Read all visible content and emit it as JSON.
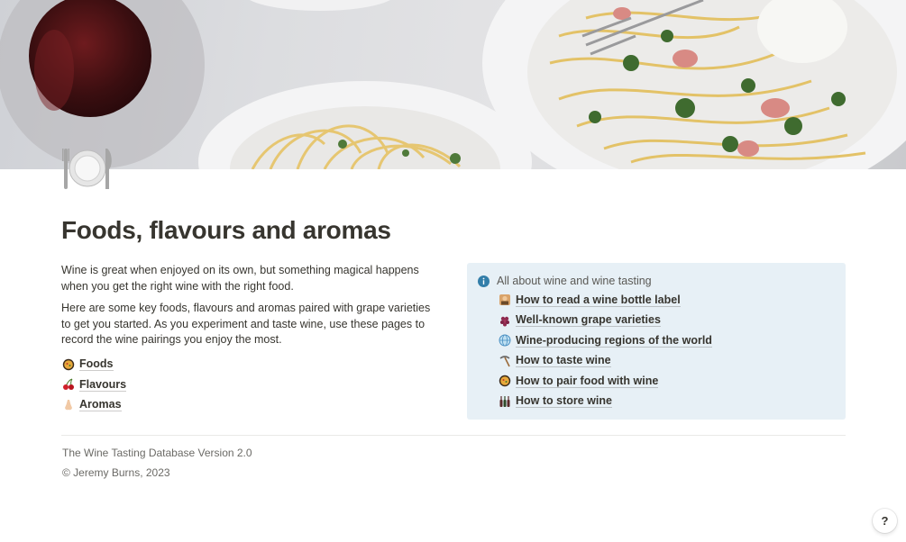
{
  "page": {
    "title": "Foods, flavours and aromas",
    "icon": "fork-knife-plate-icon"
  },
  "intro": {
    "para1": "Wine is great when enjoyed on its own, but something magical happens when you get the right wine with the right food.",
    "para2": "Here are some key foods, flavours and aromas paired with grape varieties to get you started. As you experiment and taste wine, use these pages to record the wine pairings you enjoy the most."
  },
  "links": [
    {
      "label": "Foods",
      "icon": "paella-pan-icon"
    },
    {
      "label": "Flavours",
      "icon": "cherries-icon"
    },
    {
      "label": "Aromas",
      "icon": "nose-icon"
    }
  ],
  "callout": {
    "heading": "All about wine and wine tasting",
    "icon": "info-icon",
    "color": "#e7f0f6",
    "items": [
      {
        "label": "How to read a wine bottle label",
        "icon": "person-reading-icon"
      },
      {
        "label": "Well-known grape varieties",
        "icon": "grapes-icon"
      },
      {
        "label": "Wine-producing regions of the world",
        "icon": "globe-icon"
      },
      {
        "label": "How to taste wine",
        "icon": "pick-icon"
      },
      {
        "label": "How to pair food with wine",
        "icon": "paella-pan-icon"
      },
      {
        "label": "How to store wine",
        "icon": "wine-bottles-icon"
      }
    ]
  },
  "footer": {
    "line1": "The Wine Tasting Database Version 2.0",
    "line2": "© Jeremy Burns, 2023"
  },
  "help": {
    "label": "?"
  }
}
